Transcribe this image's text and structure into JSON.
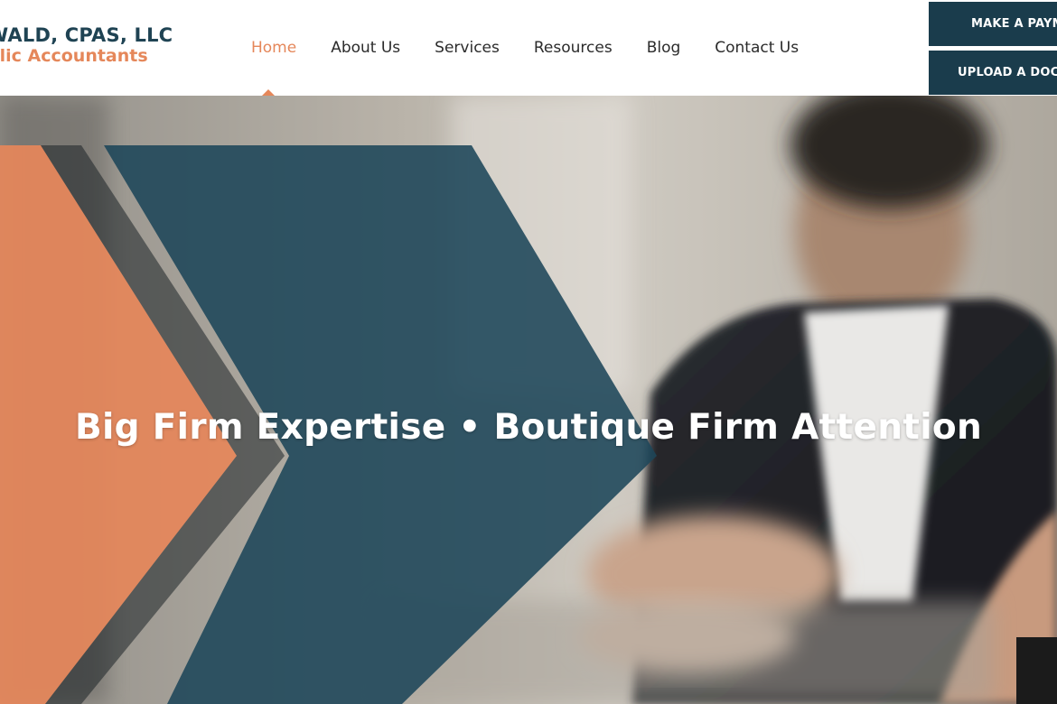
{
  "header": {
    "logo": {
      "line1": "WALD, CPAS, LLC",
      "line2": "blic Accountants"
    },
    "nav": [
      {
        "label": "Home",
        "active": true
      },
      {
        "label": "About Us",
        "active": false
      },
      {
        "label": "Services",
        "active": false
      },
      {
        "label": "Resources",
        "active": false
      },
      {
        "label": "Blog",
        "active": false
      },
      {
        "label": "Contact Us",
        "active": false
      }
    ],
    "buttons": {
      "payment_label": "MAKE A PAYMENT",
      "upload_label": "UPLOAD A DOCUMENT"
    }
  },
  "hero": {
    "headline": "Big Firm Expertise • Boutique Firm Attention"
  },
  "colors": {
    "brand_navy": "#1a3c4c",
    "brand_orange": "#e5875a",
    "nav_text": "#2b2b2b"
  },
  "icons": {
    "nav_active_marker": "caret-up-icon"
  }
}
